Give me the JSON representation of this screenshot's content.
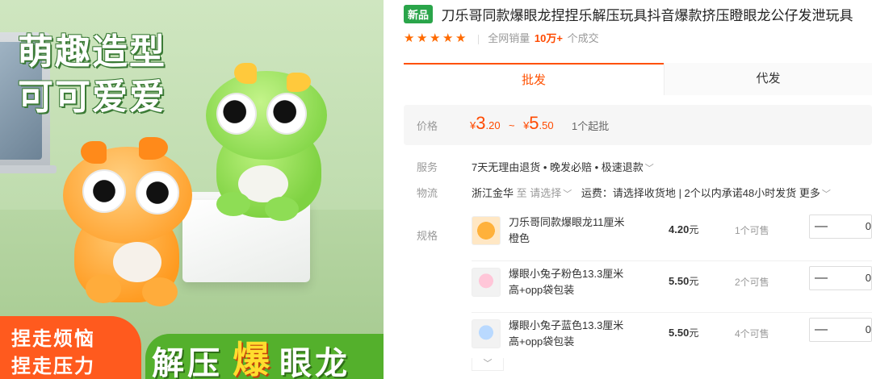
{
  "hero": {
    "slogan_line1": "萌趣造型",
    "slogan_line2": "可可爱爱",
    "banner_left_line1": "捏走烦恼",
    "banner_left_line2": "捏走压力",
    "banner_right_a": "解压",
    "banner_right_b": "爆",
    "banner_right_c": "眼龙"
  },
  "product": {
    "badge": "新品",
    "title": "刀乐哥同款爆眼龙捏捏乐解压玩具抖音爆款挤压瞪眼龙公仔发泄玩具",
    "stars": [
      "★",
      "★",
      "★",
      "★",
      "★"
    ],
    "sales_label": "全网销量",
    "sales_value": "10万+",
    "sales_suffix": "个成交"
  },
  "tabs": {
    "wholesale": "批发",
    "dropship": "代发"
  },
  "price": {
    "label": "价格",
    "yen1": "¥",
    "low_int": "3",
    "low_dec": ".20",
    "tilde": "~",
    "yen2": "¥",
    "high_int": "5",
    "high_dec": ".50",
    "min_order": "1个起批"
  },
  "service": {
    "label": "服务",
    "value": "7天无理由退货 • 晚发必赔 • 极速退款",
    "chevron": "﹀"
  },
  "logistics": {
    "label": "物流",
    "origin": "浙江金华",
    "to": "至",
    "select_placeholder": "请选择",
    "chevron": "﹀",
    "freight": "运费：请选择收货地",
    "promise": "| 2个以内承诺48小时发货",
    "more": "更多",
    "more_chevron": "﹀"
  },
  "spec": {
    "label": "规格",
    "items": [
      {
        "name": "刀乐哥同款爆眼龙11厘米橙色",
        "price": "4.20",
        "unit": "元",
        "stock": "1个可售",
        "minus": "—",
        "qty": "0"
      },
      {
        "name": "爆眼小兔子粉色13.3厘米高+opp袋包装",
        "price": "5.50",
        "unit": "元",
        "stock": "2个可售",
        "minus": "—",
        "qty": "0"
      },
      {
        "name": "爆眼小兔子蓝色13.3厘米高+opp袋包装",
        "price": "5.50",
        "unit": "元",
        "stock": "4个可售",
        "minus": "—",
        "qty": "0"
      }
    ],
    "expand_icon": "﹀"
  },
  "colors": {
    "accent": "#ff5000",
    "price": "#ff4a00",
    "badge_green": "#2aa54a"
  }
}
